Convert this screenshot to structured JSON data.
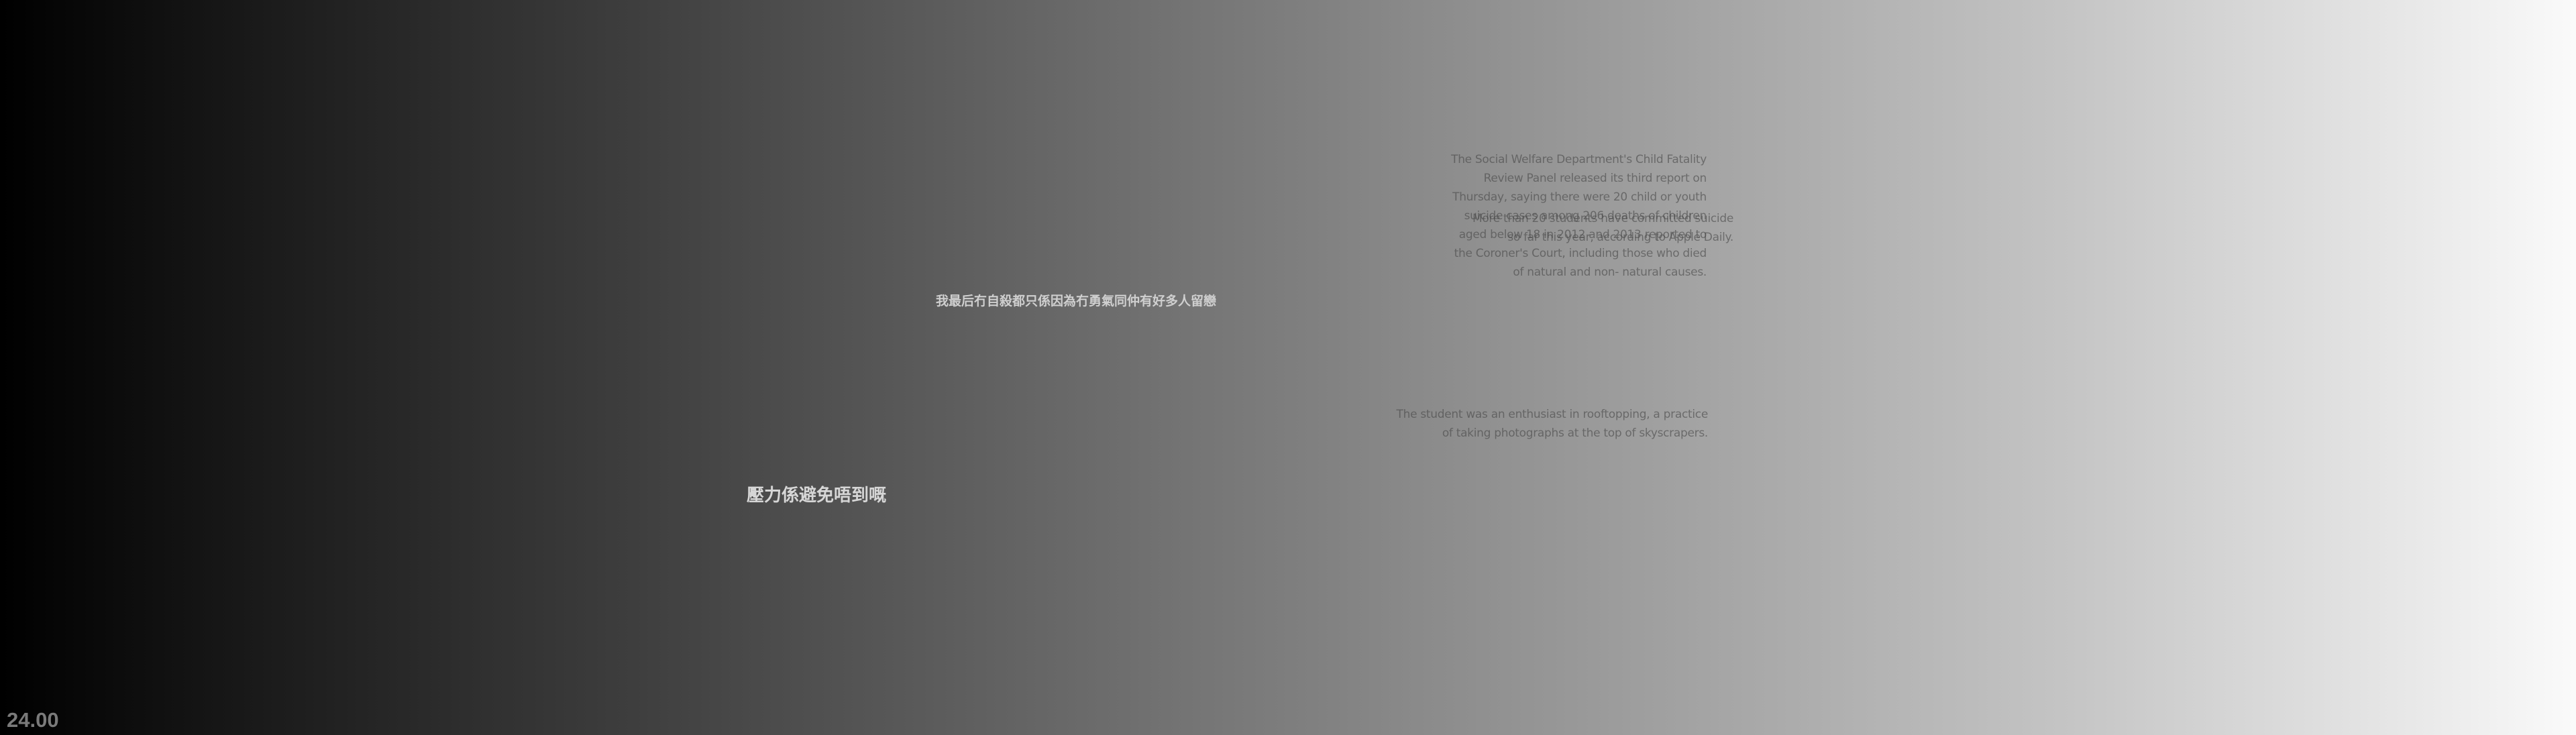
{
  "subtitles": {
    "paragraph_1": "The Social Welfare Department's Child Fatality Review Panel released its third report on Thursday, saying there were 20 child or youth suicide cases among 206 deaths of children aged below 18 in 2012 and 2013 reported to the Coroner's Court, including those who died of natural and non- natural causes.",
    "paragraph_2": "More than 20 students have committed suicide so far this year, according to Apple Daily.",
    "paragraph_3": "The student was an enthusiast in rooftopping, a practice of taking photographs at the top of skyscrapers.",
    "chinese_line_1": "我最后冇自殺都只係因為冇勇氣同仲有好多人留戀",
    "chinese_line_2": "壓力係避免唔到嘅"
  },
  "timestamp": "24.00",
  "colors": {
    "background_start": "#000000",
    "background_end": "#fafafa"
  }
}
